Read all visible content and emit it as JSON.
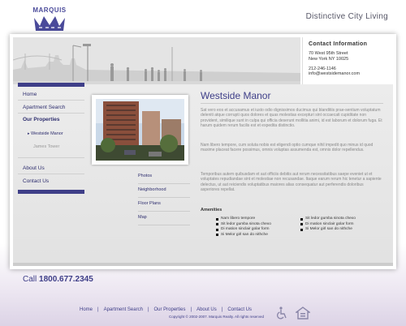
{
  "brand": {
    "name": "MARQUIS",
    "tagline": "Distinctive City Living"
  },
  "contact": {
    "title": "Contact  Information",
    "address1": "70 West 95th Street",
    "address2": "New York NY 10025",
    "phone": "212-246-1146",
    "email": "info@westsidemanor.com"
  },
  "nav": {
    "home": "Home",
    "apartment_search": "Apartment Search",
    "our_properties": "Our Properties",
    "westside_manor": "Westside Manor",
    "james_tower": "James Tower",
    "about_us": "About Us",
    "contact_us": "Contact Us"
  },
  "photo_links": [
    "Photos",
    "Neighborhood",
    "Floor Plans",
    "Map"
  ],
  "content": {
    "title": "Westside Manor",
    "para1": "Sat vero eos et accusamus et iusto odio dignissimos ducimus qui blanditiis prae-sentium voluptatum deleniti atque corrupti quos dolores et quas molestias excepturi sint occaecati cupiditate non provident, similique sunt in culpa qui officia deserunt mollitia animi, id est laborum et dolorum fuga. Et harum quidem rerum facilis est et expedita distinctio.",
    "para2": "Nam libero tempore, cum soluta nobis est eligendi optio cumque nihil impedit quo minus id quod maxime placeat facere possimus, omnis voluptas assumenda est, omnis dolor repellendus.",
    "para3": "Temporibus autem quibusdam et aut officiis debitis aut rerum necessitatibus saepe eveniet ut et voluptates repudiandae sint et molestiae non recusandae. Itaque earum rerum hic tenetur a sapiente delectus, ut aut reiciendis voluptatibus maiores alias consequatur aut perferendis doloribus asperiores repellat.",
    "amenities_title": "Amenities",
    "amenities_left": [
      "Nam libero tempore",
      "Sit ledor gumba sinota chexo",
      "Di mation sinclair golar form",
      "Si Melor girl san do nithche"
    ],
    "amenities_right": [
      "Sit ledor gumba sinota chexo",
      "Di mation sinclair golar form",
      "Si Melor girl san do nithche"
    ]
  },
  "footer": {
    "call_label": "Call",
    "phone": "1800.677.2345",
    "links": [
      "Home",
      "Apartment Search",
      "Our Properties",
      "About Us",
      "Contact Us"
    ],
    "copyright": "Copyright © 2002-2007. Marquis Realty. All rights reserved"
  },
  "colors": {
    "accent": "#3e3e88",
    "text": "#888888",
    "band": "#e6e6e6"
  }
}
